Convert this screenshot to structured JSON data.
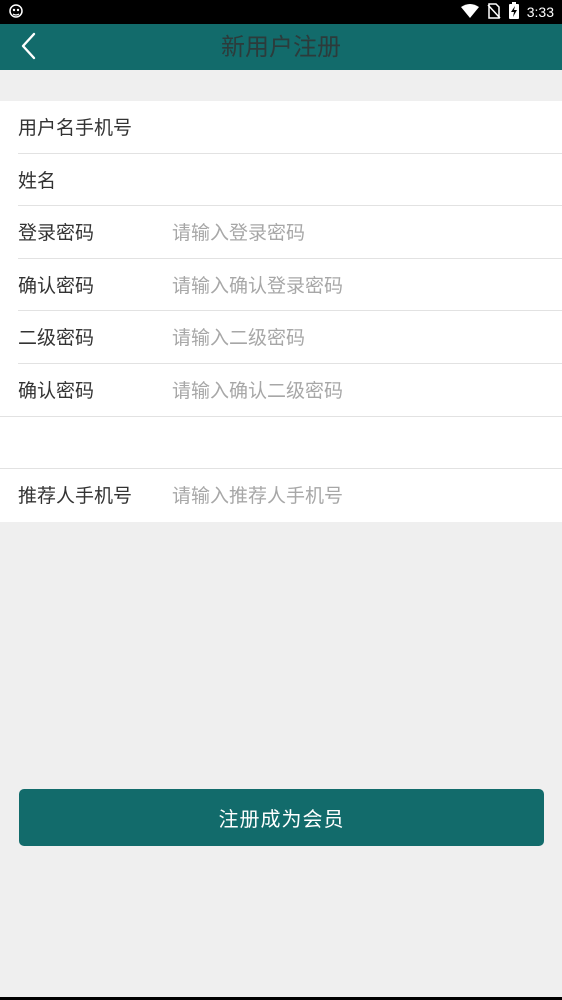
{
  "status_bar": {
    "time": "3:33"
  },
  "app_bar": {
    "title": "新用户注册"
  },
  "form": {
    "rows": [
      {
        "label": "用户名手机号",
        "value": "",
        "placeholder": ""
      },
      {
        "label": "姓名",
        "value": "",
        "placeholder": ""
      },
      {
        "label": "登录密码",
        "value": "",
        "placeholder": "请输入登录密码"
      },
      {
        "label": "确认密码",
        "value": "",
        "placeholder": "请输入确认登录密码"
      },
      {
        "label": "二级密码",
        "value": "",
        "placeholder": "请输入二级密码"
      },
      {
        "label": "确认密码",
        "value": "",
        "placeholder": "请输入确认二级密码"
      },
      {
        "label": "推荐人手机号",
        "value": "",
        "placeholder": "请输入推荐人手机号"
      }
    ]
  },
  "submit": {
    "label": "注册成为会员"
  },
  "colors": {
    "primary": "#126b6b",
    "title_text": "#2c3b3b",
    "background": "#efefef"
  },
  "icons": [
    "app-notification-icon",
    "wifi-icon",
    "no-sim-icon",
    "battery-charging-icon",
    "back-arrow-icon"
  ]
}
